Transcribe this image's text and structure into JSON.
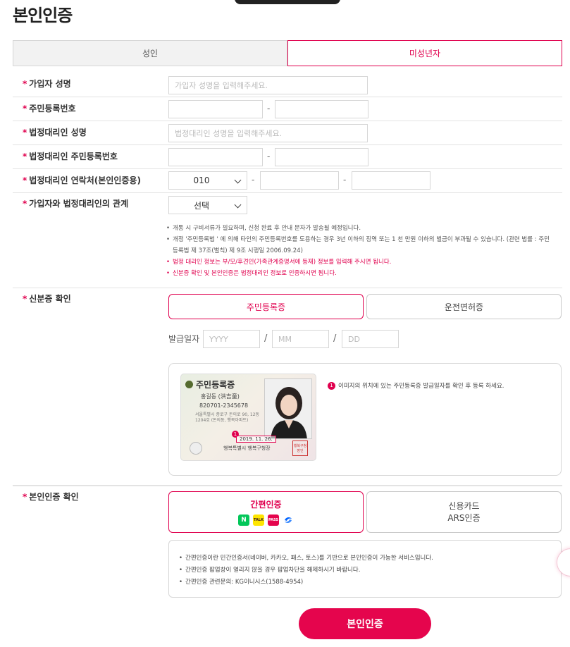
{
  "page": {
    "title": "본인인증"
  },
  "tabs": [
    {
      "label": "성인",
      "active": false
    },
    {
      "label": "미성년자",
      "active": true
    }
  ],
  "form": {
    "name": {
      "label": "가입자 성명",
      "placeholder": "가입자 성명을 입력해주세요."
    },
    "rrn": {
      "label": "주민등록번호",
      "separator": "-"
    },
    "guardian_name": {
      "label": "법정대리인 성명",
      "placeholder": "법정대리인 성명을 입력해주세요."
    },
    "guardian_rrn": {
      "label": "법정대리인 주민등록번호",
      "separator": "-"
    },
    "guardian_phone": {
      "label": "법정대리인 연락처(본인인증용)",
      "prefix": "010",
      "separator": "-"
    },
    "relation": {
      "label": "가입자와 법정대리인의 관계",
      "selected": "선택"
    }
  },
  "notes": [
    {
      "text": "개통 시 구비서류가 필요하며, 신청 완료 후 안내 문자가 발송될 예정입니다.",
      "emphasis": false
    },
    {
      "text": "개정 '주민등록법 ' 에 의해 타인의 주민등록번호를 도용하는 경우 3년 이하의 징역 또는 1 천 만원 이하의 벌금이 부과될 수 있습니다. (관련 법률 : 주민등록법 제 37조(벌칙) 제 9조 시행일 2006.09.24)",
      "emphasis": false
    },
    {
      "text": "법정 대리인 정보는 부/모/후견인(가족관계증명서에 등재) 정보를 입력해 주시면 됩니다.",
      "emphasis": true
    },
    {
      "text": "신분증 확인 및 본인인증은 법정대리인 정보로 인증하시면 됩니다.",
      "emphasis": true
    }
  ],
  "id_check": {
    "label": "신분증 확인",
    "options": [
      {
        "label": "주민등록증",
        "active": true
      },
      {
        "label": "운전면허증",
        "active": false
      }
    ],
    "issue_date": {
      "label": "발급일자",
      "year_placeholder": "YYYY",
      "month_placeholder": "MM",
      "day_placeholder": "DD",
      "separator": "/"
    },
    "sample_card": {
      "title": "주민등록증",
      "name": "홍길동 (洪吉童)",
      "number": "820701-2345678",
      "address": "서울특별시 종로구 돈의로 90, 12동 1204호 (돈의동, 행복아파트)",
      "issue_date": "2019. 11. 26.",
      "issuer": "행복특별시 행복구청장",
      "seal": "행복구청장인",
      "marker": "1"
    },
    "description_badge": "1",
    "description": "이미지의 위치에 있는 주민등록증 발급일자를 확인 후 등록 하세요."
  },
  "auth": {
    "label": "본인인증 확인",
    "options": [
      {
        "label": "간편인증",
        "active": true
      },
      {
        "label": "신용카드\nARS인증",
        "active": false
      }
    ],
    "providers": [
      {
        "icon": "naver-logo",
        "text": "N",
        "bg": "#03c75a",
        "fg": "#ffffff"
      },
      {
        "icon": "kakao-talk-logo",
        "text": "TALK",
        "bg": "#fee500",
        "fg": "#3c1e1e"
      },
      {
        "icon": "pass-logo",
        "text": "PASS",
        "bg": "#e5054d",
        "fg": "#ffffff"
      },
      {
        "icon": "toss-logo",
        "text": "",
        "bg": "#ffffff",
        "fg": "#0064ff"
      }
    ],
    "info": [
      "간편인증이란 민간인증서(네이버, 카카오, 패스, 토스)를 기반으로 본인인증이 가능한 서비스입니다.",
      "간편인증 팝업창이 열리지 않을 경우 팝업차단을 해제하시기 바랍니다.",
      "간편인증 관련문의: KG이니시스(1588-4954)"
    ]
  },
  "submit_label": "본인인증",
  "colors": {
    "accent": "#e0004e",
    "button": "#e5054d",
    "border": "#d6d6d6"
  }
}
